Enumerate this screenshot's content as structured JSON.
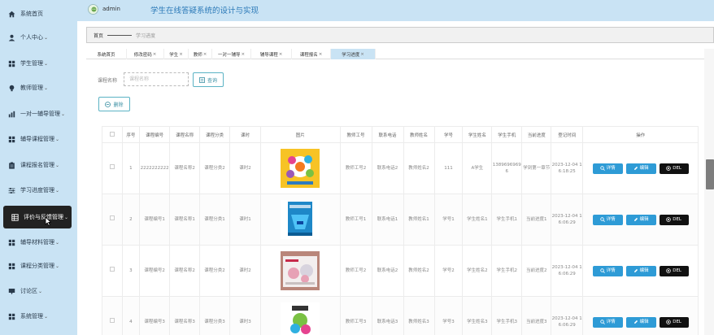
{
  "header": {
    "username": "admin",
    "title": "学生在线答疑系统的设计与实现"
  },
  "sidebar": {
    "items": [
      {
        "label": "系统首页",
        "icon": "home-icon",
        "chevron": ""
      },
      {
        "label": "个人中心",
        "icon": "user-icon",
        "chevron": "⌄"
      },
      {
        "label": "学生管理",
        "icon": "grid-icon",
        "chevron": "⌄"
      },
      {
        "label": "教师管理",
        "icon": "bulb-icon",
        "chevron": "⌄"
      },
      {
        "label": "一对一辅导管理",
        "icon": "chart-icon",
        "chevron": "⌄"
      },
      {
        "label": "辅导课程管理",
        "icon": "grid-icon",
        "chevron": "⌄"
      },
      {
        "label": "课程报名管理",
        "icon": "clipboard-icon",
        "chevron": "⌄"
      },
      {
        "label": "学习进度管理",
        "icon": "sliders-icon",
        "chevron": "⌄"
      },
      {
        "label": "评价与反馈管理",
        "icon": "table-icon",
        "chevron": "⌄"
      },
      {
        "label": "辅导材料管理",
        "icon": "grid-icon",
        "chevron": "⌄"
      },
      {
        "label": "课程分类管理",
        "icon": "grid-icon",
        "chevron": "⌄"
      },
      {
        "label": "讨论区",
        "icon": "chat-icon",
        "chevron": "⌄"
      },
      {
        "label": "系统管理",
        "icon": "grid-icon",
        "chevron": "⌄"
      }
    ],
    "active_index": 8
  },
  "breadcrumb": {
    "home": "首页",
    "current": "学习进度"
  },
  "tabs": [
    {
      "label": "系统首页",
      "closable": false
    },
    {
      "label": "修改密码",
      "closable": true
    },
    {
      "label": "学生",
      "closable": true
    },
    {
      "label": "教师",
      "closable": true
    },
    {
      "label": "一对一辅导",
      "closable": true
    },
    {
      "label": "辅导课程",
      "closable": true
    },
    {
      "label": "课程报名",
      "closable": true
    },
    {
      "label": "学习进度",
      "closable": true,
      "active": true
    }
  ],
  "search": {
    "label": "课程名称",
    "placeholder": "课程名称",
    "button_label": "查询"
  },
  "toolbar": {
    "delete_label": "删除"
  },
  "table": {
    "columns": [
      "序号",
      "课程编号",
      "课程名称",
      "课程分类",
      "课时",
      "图片",
      "教师工号",
      "联系电话",
      "教师姓名",
      "学号",
      "学生姓名",
      "学生手机",
      "当前进度",
      "登记时间",
      "操作"
    ],
    "rows": [
      {
        "no": "1",
        "course_no": "2222222222",
        "course_name": "课程名称2",
        "category": "课程分类2",
        "hours": "课时2",
        "image": "book-cover-1",
        "teacher_no": "教师工号2",
        "phone": "联系电话2",
        "teacher_name": "教师姓名2",
        "student_no": "111",
        "student_name": "A学生",
        "student_phone": "13896969696",
        "progress": "学到第一章节",
        "time": "2023-12-04 16:18:25"
      },
      {
        "no": "2",
        "course_no": "课程编号1",
        "course_name": "课程名称1",
        "category": "课程分类1",
        "hours": "课时1",
        "image": "book-cover-2",
        "teacher_no": "教师工号1",
        "phone": "联系电话1",
        "teacher_name": "教师姓名1",
        "student_no": "学号1",
        "student_name": "学生姓名1",
        "student_phone": "学生手机1",
        "progress": "当前进度1",
        "time": "2023-12-04 16:06:29"
      },
      {
        "no": "3",
        "course_no": "课程编号2",
        "course_name": "课程名称2",
        "category": "课程分类2",
        "hours": "课时2",
        "image": "book-cover-3",
        "teacher_no": "教师工号2",
        "phone": "联系电话2",
        "teacher_name": "教师姓名2",
        "student_no": "学号2",
        "student_name": "学生姓名2",
        "student_phone": "学生手机2",
        "progress": "当前进度2",
        "time": "2023-12-04 16:06:29"
      },
      {
        "no": "4",
        "course_no": "课程编号3",
        "course_name": "课程名称3",
        "category": "课程分类3",
        "hours": "课时3",
        "image": "book-cover-4",
        "teacher_no": "教师工号3",
        "phone": "联系电话3",
        "teacher_name": "教师姓名3",
        "student_no": "学号3",
        "student_name": "学生姓名3",
        "student_phone": "学生手机3",
        "progress": "当前进度3",
        "time": "2023-12-04 16:06:29"
      }
    ],
    "actions": {
      "detail": "详情",
      "edit": "编辑",
      "delete": "DEL"
    }
  },
  "colors": {
    "sidebar_bg": "#c9e3f4",
    "active_item_bg": "#222222",
    "primary_button": "#2e9bd6",
    "delete_button": "#111111",
    "title_text": "#2c7ab8"
  }
}
